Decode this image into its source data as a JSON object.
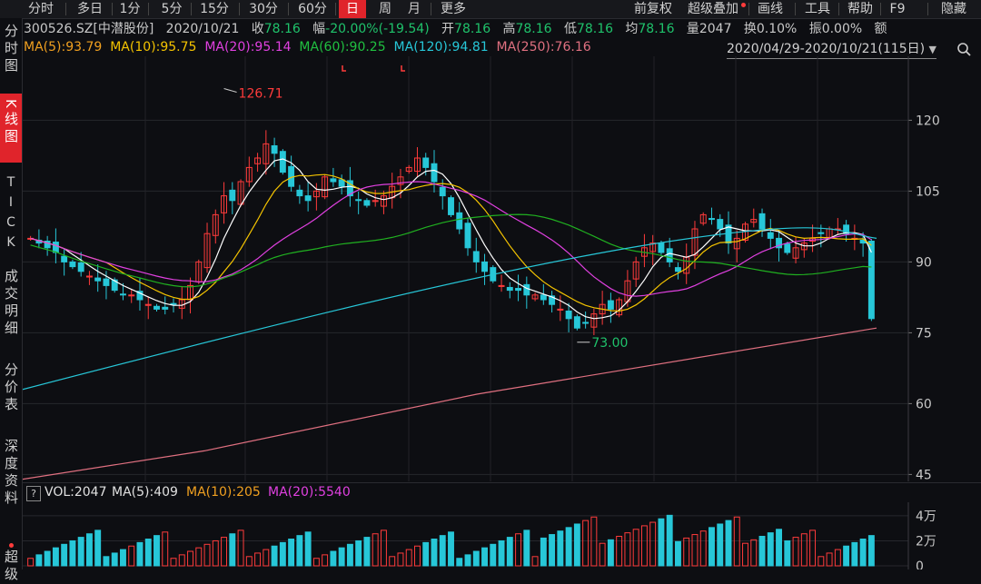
{
  "toolbar": {
    "periods": [
      "分时",
      "多日",
      "1分",
      "5分",
      "15分",
      "30分",
      "60分",
      "日",
      "周",
      "月",
      "更多"
    ],
    "active_period": "日",
    "right": [
      "前复权",
      "超级叠加",
      "画线",
      "工具",
      "帮助",
      "F9",
      "隐藏"
    ]
  },
  "sidebar": [
    "分时图",
    "K线图",
    "TICK",
    "成交明细",
    "分价表",
    "深度资料",
    "超级"
  ],
  "sidebar_active": "K线图",
  "quote": {
    "code": "300526.SZ[中潜股份]",
    "date": "2020/10/21",
    "close_label": "收",
    "close": "78.16",
    "change_label": "幅",
    "change": "-20.00%(-19.54)",
    "open_label": "开",
    "open": "78.16",
    "high_label": "高",
    "high": "78.16",
    "low_label": "低",
    "low": "78.16",
    "avg_label": "均",
    "avg": "78.16",
    "vol_label": "量",
    "vol": "2047",
    "turnover_label": "换",
    "turnover": "0.10%",
    "amp_label": "振",
    "amp": "0.00%",
    "amount_label": "额"
  },
  "ma": {
    "ma5": "MA(5):93.79",
    "ma10": "MA(10):95.75",
    "ma20": "MA(20):95.14",
    "ma60": "MA(60):90.25",
    "ma120": "MA(120):94.81",
    "ma250": "MA(250):76.16"
  },
  "range": "2020/04/29-2020/10/21(115日)",
  "colors": {
    "ma5": "#ffffff",
    "ma10": "#f5c400",
    "ma20": "#e040e0",
    "ma60": "#20b020",
    "ma120": "#27c7d8",
    "ma250": "#e07080",
    "up": "#ff3b3b",
    "down": "#27c7d8",
    "bg": "#0d0e12"
  },
  "annotations": {
    "high": "126.71",
    "low": "73.00"
  },
  "volume": {
    "vol": "VOL:2047",
    "ma5": "MA(5):409",
    "ma10": "MA(10):205",
    "ma20": "MA(20):5540",
    "help": "?"
  },
  "chart_data": [
    {
      "type": "candlestick",
      "yticks": [
        120,
        105,
        90,
        75,
        60,
        45
      ],
      "ylim": [
        42,
        132
      ]
    },
    {
      "type": "bar",
      "yticks": [
        "4万",
        "2万",
        "0"
      ]
    }
  ]
}
